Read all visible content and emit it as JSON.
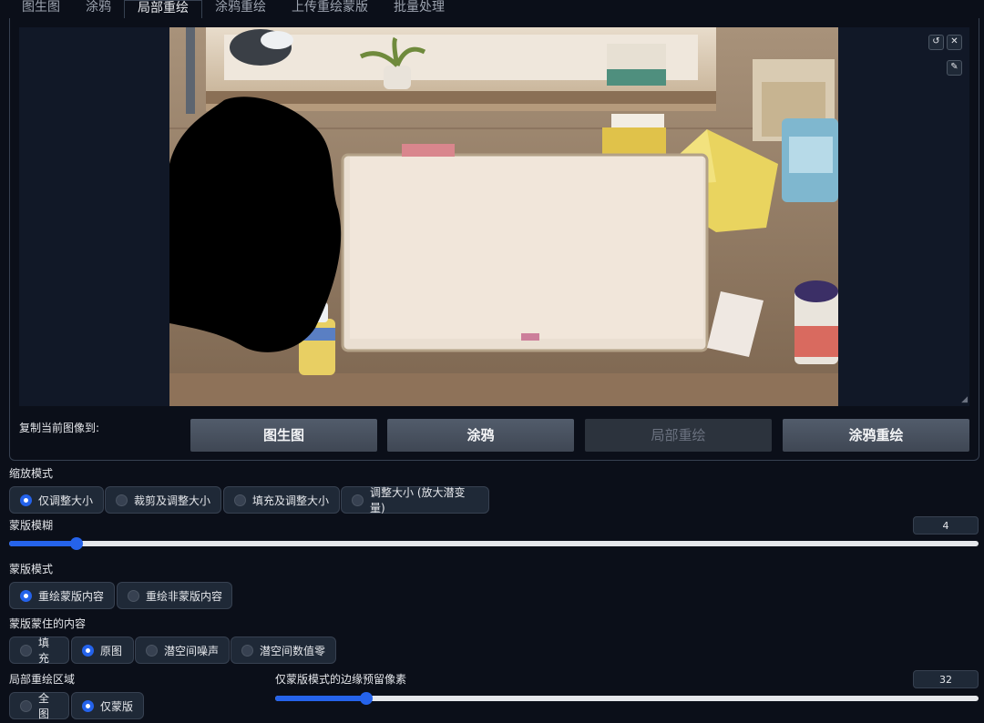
{
  "tabs": [
    "图生图",
    "涂鸦",
    "局部重绘",
    "涂鸦重绘",
    "上传重绘蒙版",
    "批量处理"
  ],
  "active_tab": "局部重绘",
  "toolbar": {
    "undo_icon": "undo-icon",
    "close_icon": "close-icon",
    "brush_icon": "brush-icon"
  },
  "copy": {
    "label": "复制当前图像到:",
    "buttons": [
      "图生图",
      "涂鸦",
      "局部重绘",
      "涂鸦重绘"
    ],
    "disabled": "局部重绘"
  },
  "resize_mode": {
    "label": "缩放模式",
    "options": [
      "仅调整大小",
      "裁剪及调整大小",
      "填充及调整大小",
      "调整大小 (放大潜变量)"
    ],
    "selected": "仅调整大小"
  },
  "mask_blur": {
    "label": "蒙版模糊",
    "value": "4",
    "fraction": 0.07
  },
  "mask_mode": {
    "label": "蒙版模式",
    "options": [
      "重绘蒙版内容",
      "重绘非蒙版内容"
    ],
    "selected": "重绘蒙版内容"
  },
  "masked_content": {
    "label": "蒙版蒙住的内容",
    "options": [
      "填充",
      "原图",
      "潜空间噪声",
      "潜空间数值零"
    ],
    "selected": "原图"
  },
  "inpaint_area": {
    "label": "局部重绘区域",
    "options": [
      "全图",
      "仅蒙版"
    ],
    "selected": "仅蒙版"
  },
  "padding": {
    "label": "仅蒙版模式的边缘预留像素",
    "value": "32",
    "fraction": 0.13
  },
  "colors": {
    "accent": "#2563eb",
    "background": "#0b0f19",
    "panel": "#1f2937"
  }
}
